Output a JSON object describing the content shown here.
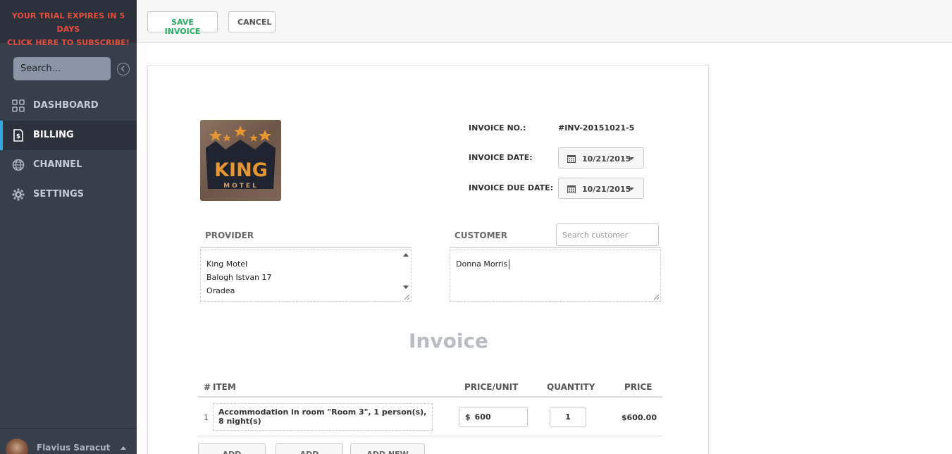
{
  "trial": {
    "line1": "YOUR TRIAL EXPIRES IN 5 DAYS",
    "line2": "CLICK HERE TO SUBSCRIBE!"
  },
  "sidebar": {
    "search_placeholder": "Search...",
    "items": [
      {
        "label": "DASHBOARD",
        "icon": "grid-icon",
        "active": false
      },
      {
        "label": "BILLING",
        "icon": "invoice-dollar-icon",
        "active": true
      },
      {
        "label": "CHANNEL",
        "icon": "globe-icon",
        "active": false
      },
      {
        "label": "SETTINGS",
        "icon": "gear-icon",
        "active": false
      }
    ],
    "user_name": "Flavius Saracut"
  },
  "toolbar": {
    "save_label": "SAVE INVOICE",
    "cancel_label": "CANCEL"
  },
  "invoice": {
    "logo": {
      "text": "KING",
      "subtext": "MOTEL"
    },
    "number_label": "INVOICE NO.:",
    "number_value": "#INV-20151021-5",
    "date_label": "INVOICE DATE:",
    "date_value": "10/21/2015",
    "due_label": "INVOICE DUE DATE:",
    "due_value": "10/21/2015",
    "provider_heading": "PROVIDER",
    "provider_lines": [
      "King Motel",
      "Balogh Istvan 17",
      "Oradea"
    ],
    "customer_heading": "CUSTOMER",
    "customer_search_placeholder": "Search customer",
    "customer_text": "Donna Morris",
    "title": "Invoice",
    "table": {
      "headers": {
        "num": "#",
        "item": "ITEM",
        "price_unit": "PRICE/UNIT",
        "quantity": "QUANTITY",
        "price": "PRICE"
      },
      "rows": [
        {
          "num": "1",
          "item": "Accommodation in room \"Room 3\", 1 person(s), 8 night(s)",
          "currency": "$",
          "price_unit": "600",
          "quantity": "1",
          "price": "$600.00"
        }
      ]
    },
    "buttons": {
      "add_booking": "ADD BOOKING",
      "add_service": "ADD SERVICE",
      "add_new_row": "ADD NEW ROW"
    }
  },
  "colors": {
    "sidebar_bg": "#363f4a",
    "sidebar_dark": "#2b323b",
    "accent": "#2ea8e5",
    "trial_red": "#e74c3c",
    "save_green": "#27ae60"
  }
}
